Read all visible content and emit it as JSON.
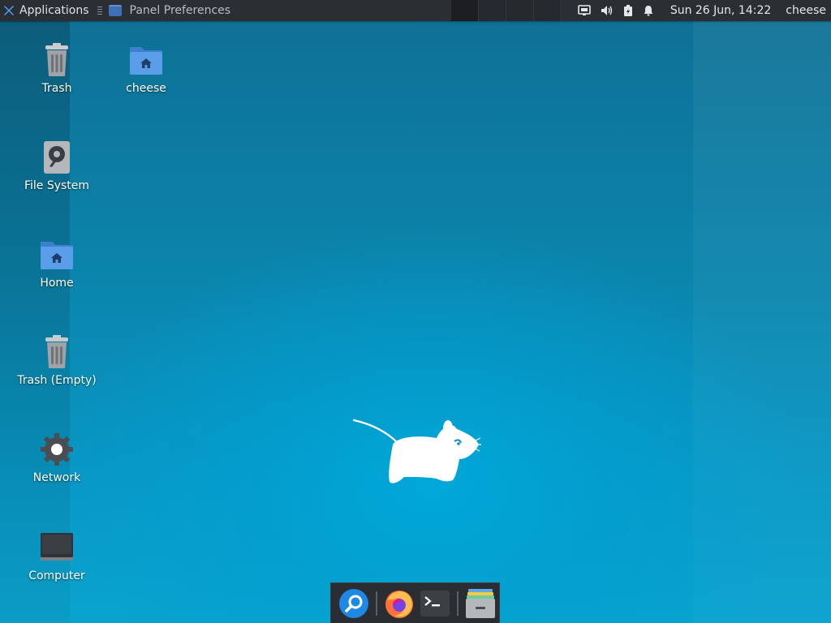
{
  "panel": {
    "applications_label": "Applications",
    "task_title": "Panel Preferences",
    "clock": "Sun 26 Jun, 14:22",
    "user": "cheese",
    "workspaces": [
      "1",
      "2",
      "3",
      "4"
    ],
    "tray_icons": [
      "network-icon",
      "volume-icon",
      "battery-icon",
      "notification-bell-icon"
    ]
  },
  "desktop": {
    "icons": [
      {
        "label": "Trash",
        "icon": "trash-icon"
      },
      {
        "label": "cheese",
        "icon": "home-folder-icon"
      },
      {
        "label": "File System",
        "icon": "hard-drive-icon"
      },
      {
        "label": "Home",
        "icon": "home-folder-icon"
      },
      {
        "label": "Trash (Empty)",
        "icon": "trash-icon"
      },
      {
        "label": "Network",
        "icon": "network-gear-icon"
      },
      {
        "label": "Computer",
        "icon": "monitor-icon"
      }
    ]
  },
  "dock": {
    "items": [
      "app-finder-icon",
      "firefox-icon",
      "terminal-icon",
      "file-manager-icon"
    ]
  },
  "colors": {
    "panel_bg": "#2b2e33",
    "desktop_accent": "#0aa3cf",
    "folder_blue": "#4a8fe0"
  }
}
